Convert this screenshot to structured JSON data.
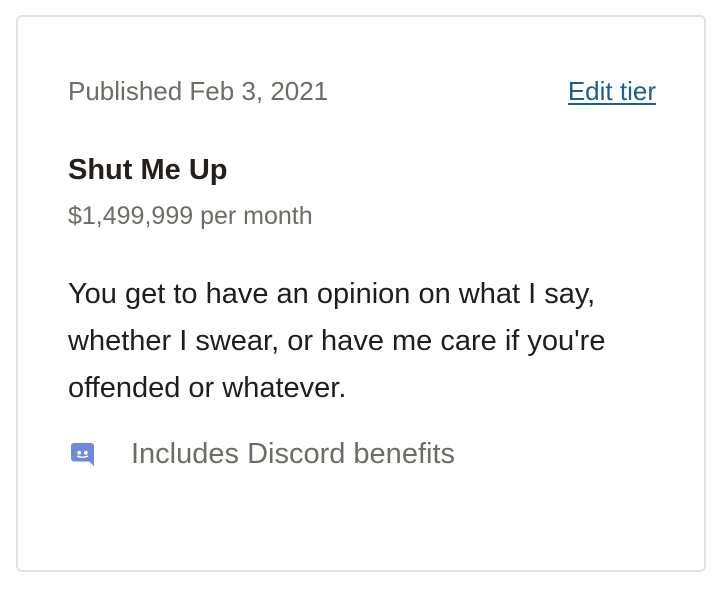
{
  "tier": {
    "published_label": "Published Feb 3, 2021",
    "edit_label": "Edit tier",
    "title": "Shut Me Up",
    "price": "$1,499,999 per month",
    "description": "You get to have an opinion on what I say, whether I swear, or have me care if you're offended or whatever.",
    "benefit": {
      "icon": "discord-icon",
      "label": "Includes Discord benefits"
    }
  },
  "colors": {
    "link": "#1a5f8f",
    "discord": "#7289da",
    "muted_text": "#6f6c66",
    "border": "#e3e2df"
  }
}
